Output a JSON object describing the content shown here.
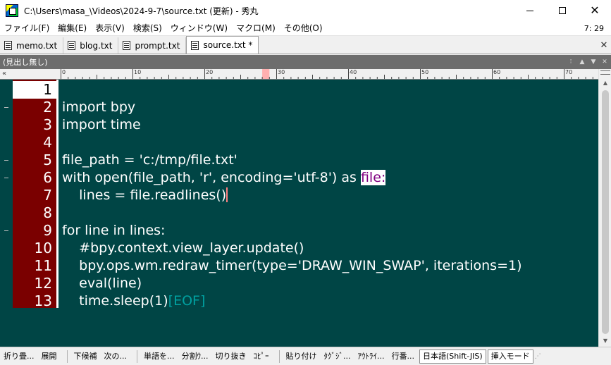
{
  "window": {
    "title": "C:\\Users\\masa_\\Videos\\2024-9-7\\source.txt (更新) - 秀丸",
    "minimize_label": "—",
    "maximize_label": "",
    "close_label": "✕"
  },
  "menu": {
    "items": [
      "ファイル(F)",
      "編集(E)",
      "表示(V)",
      "検索(S)",
      "ウィンドウ(W)",
      "マクロ(M)",
      "その他(O)"
    ],
    "cursor_position": "7: 29"
  },
  "tabs": {
    "items": [
      {
        "label": "memo.txt",
        "active": false
      },
      {
        "label": "blog.txt",
        "active": false
      },
      {
        "label": "prompt.txt",
        "active": false
      },
      {
        "label": "source.txt *",
        "active": true
      }
    ],
    "close_glyph": "✕"
  },
  "outline": {
    "label": "(見出し無し)"
  },
  "ruler": {
    "corner": "«",
    "labels": [
      "0",
      "10",
      "20",
      "30",
      "40",
      "50",
      "60",
      "70"
    ]
  },
  "editor": {
    "current_line": 1,
    "lines": [
      {
        "no": "1",
        "text": "",
        "fold": false
      },
      {
        "no": "2",
        "text": "import bpy",
        "fold": true
      },
      {
        "no": "3",
        "text": "import time",
        "fold": false
      },
      {
        "no": "4",
        "text": "",
        "fold": false
      },
      {
        "no": "5",
        "text": "file_path = 'c:/tmp/file.txt'",
        "fold": true
      },
      {
        "no": "6",
        "text": "with open(file_path, 'r', encoding='utf-8') as ",
        "hl": "file:",
        "fold": true
      },
      {
        "no": "7",
        "text": "    lines = file.readlines()",
        "caret": true,
        "fold": false
      },
      {
        "no": "8",
        "text": "",
        "fold": false
      },
      {
        "no": "9",
        "text": "for line in lines:",
        "fold": true
      },
      {
        "no": "10",
        "text": "    #bpy.context.view_layer.update()",
        "fold": false
      },
      {
        "no": "11",
        "text": "    bpy.ops.wm.redraw_timer(type='DRAW_WIN_SWAP', iterations=1)",
        "fold": false
      },
      {
        "no": "12",
        "text": "    eval(line)",
        "fold": false
      },
      {
        "no": "13",
        "text": "    time.sleep(1)",
        "eof": "[EOF]",
        "fold": false
      }
    ],
    "colors": {
      "background": "#004545",
      "gutter": "#7a0000",
      "text": "#ffffff",
      "highlight_text": "#800080",
      "eof": "#00a0a0"
    }
  },
  "statusbar": {
    "function_keys": [
      "折り畳...",
      "展開",
      "下候補",
      "次の...",
      "単語を...",
      "分割ｳ...",
      "切り抜き",
      "ｺﾋﾟｰ",
      "貼り付け",
      "ﾀｸﾞｼﾞ...",
      "ｱｳﾄﾗｲ...",
      "行番..."
    ],
    "encoding": "日本語(Shift-JIS)",
    "mode": "挿入モード"
  }
}
